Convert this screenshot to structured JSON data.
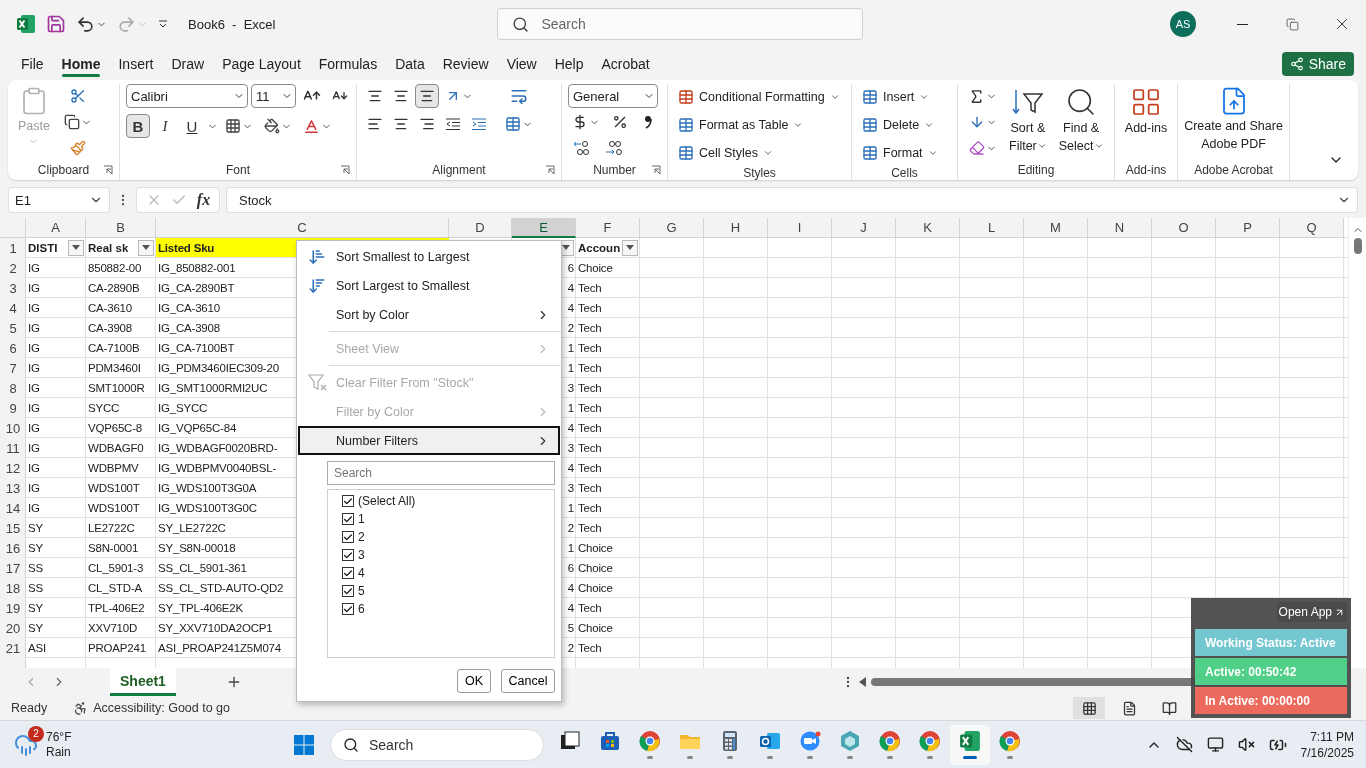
{
  "title_bar": {
    "document_title": "Book6  -  Excel",
    "search_placeholder": "Search",
    "user_initials": "AS"
  },
  "menu_tabs": [
    {
      "label": "File",
      "selected": false
    },
    {
      "label": "Home",
      "selected": true
    },
    {
      "label": "Insert",
      "selected": false
    },
    {
      "label": "Draw",
      "selected": false
    },
    {
      "label": "Page Layout",
      "selected": false
    },
    {
      "label": "Formulas",
      "selected": false
    },
    {
      "label": "Data",
      "selected": false
    },
    {
      "label": "Review",
      "selected": false
    },
    {
      "label": "View",
      "selected": false
    },
    {
      "label": "Help",
      "selected": false
    },
    {
      "label": "Acrobat",
      "selected": false
    }
  ],
  "share_button": "Share",
  "ribbon": {
    "clipboard": {
      "paste": {
        "label": "Paste",
        "disabled": true
      },
      "group_label": "Clipboard"
    },
    "font": {
      "font_name": "Calibri",
      "font_size": "11",
      "bold": {
        "label": "B",
        "on": true
      },
      "italic": {
        "label": "I",
        "on": false
      },
      "underline": {
        "label": "U",
        "on": false
      },
      "group_label": "Font"
    },
    "alignment": {
      "bottom_align_on": true,
      "group_label": "Alignment"
    },
    "number": {
      "format": "General",
      "group_label": "Number"
    },
    "styles": {
      "items": [
        "Conditional Formatting",
        "Format as Table",
        "Cell Styles"
      ],
      "group_label": "Styles"
    },
    "cells": {
      "items": [
        "Insert",
        "Delete",
        "Format"
      ],
      "group_label": "Cells"
    },
    "editing": {
      "sort_filter": [
        "Sort &",
        "Filter"
      ],
      "find_select": [
        "Find &",
        "Select"
      ],
      "group_label": "Editing"
    },
    "addins": {
      "label": "Add-ins",
      "group_label": "Add-ins"
    },
    "acrobat": {
      "lines": [
        "Create and Share",
        "Adobe PDF"
      ],
      "group_label": "Adobe Acrobat"
    }
  },
  "formula_bar": {
    "name_box": "E1",
    "function_symbol": "fx",
    "formula": "Stock"
  },
  "sheet": {
    "columns": [
      {
        "label": "A",
        "selected": false
      },
      {
        "label": "B",
        "selected": false
      },
      {
        "label": "C",
        "selected": false
      },
      {
        "label": "D",
        "selected": false
      },
      {
        "label": "E",
        "selected": true
      },
      {
        "label": "F",
        "selected": false
      },
      {
        "label": "G",
        "selected": false
      },
      {
        "label": "H",
        "selected": false
      },
      {
        "label": "I",
        "selected": false
      },
      {
        "label": "J",
        "selected": false
      },
      {
        "label": "K",
        "selected": false
      },
      {
        "label": "L",
        "selected": false
      },
      {
        "label": "M",
        "selected": false
      },
      {
        "label": "N",
        "selected": false
      },
      {
        "label": "O",
        "selected": false
      },
      {
        "label": "P",
        "selected": false
      },
      {
        "label": "Q",
        "selected": false
      }
    ],
    "header_row": {
      "number": "1",
      "a": {
        "text": "DISTI",
        "filter": true
      },
      "b": {
        "text": "Real sk",
        "filter": true
      },
      "c": {
        "text": "Listed Sku",
        "highlighted": true
      },
      "e": {
        "filter": true
      },
      "f": {
        "text": "Accoun",
        "filter": true
      }
    },
    "rows": [
      {
        "number": "2",
        "a": "IG",
        "b": "850882-00",
        "c": "IG_850882-001",
        "e": "6",
        "f": "Choice"
      },
      {
        "number": "3",
        "a": "IG",
        "b": "CA-2890B",
        "c": "IG_CA-2890BT",
        "e": "4",
        "f": "Tech"
      },
      {
        "number": "4",
        "a": "IG",
        "b": "CA-3610",
        "c": "IG_CA-3610",
        "e": "4",
        "f": "Tech"
      },
      {
        "number": "5",
        "a": "IG",
        "b": "CA-3908",
        "c": "IG_CA-3908",
        "e": "2",
        "f": "Tech"
      },
      {
        "number": "6",
        "a": "IG",
        "b": "CA-7100B",
        "c": "IG_CA-7100BT",
        "e": "1",
        "f": "Tech"
      },
      {
        "number": "7",
        "a": "IG",
        "b": "PDM3460I",
        "c": "IG_PDM3460IEC309-20",
        "e": "1",
        "f": "Tech"
      },
      {
        "number": "8",
        "a": "IG",
        "b": "SMT1000R",
        "c": "IG_SMT1000RMI2UC",
        "e": "3",
        "f": "Tech"
      },
      {
        "number": "9",
        "a": "IG",
        "b": "SYCC",
        "c": "IG_SYCC",
        "e": "1",
        "f": "Tech"
      },
      {
        "number": "10",
        "a": "IG",
        "b": "VQP65C-8",
        "c": "IG_VQP65C-84",
        "e": "4",
        "f": "Tech"
      },
      {
        "number": "11",
        "a": "IG",
        "b": "WDBAGF0",
        "c": "IG_WDBAGF0020BRD-",
        "e": "3",
        "f": "Tech"
      },
      {
        "number": "12",
        "a": "IG",
        "b": "WDBPMV",
        "c": "IG_WDBPMV0040BSL-",
        "e": "4",
        "f": "Tech"
      },
      {
        "number": "13",
        "a": "IG",
        "b": "WDS100T",
        "c": "IG_WDS100T3G0A",
        "e": "3",
        "f": "Tech"
      },
      {
        "number": "14",
        "a": "IG",
        "b": "WDS100T",
        "c": "IG_WDS100T3G0C",
        "e": "1",
        "f": "Tech"
      },
      {
        "number": "15",
        "a": "SY",
        "b": "LE2722C",
        "c": "SY_LE2722C",
        "e": "2",
        "f": "Tech"
      },
      {
        "number": "16",
        "a": "SY",
        "b": "S8N-0001",
        "c": "SY_S8N-00018",
        "e": "1",
        "f": "Choice"
      },
      {
        "number": "17",
        "a": "SS",
        "b": "CL_5901-3",
        "c": "SS_CL_5901-361",
        "e": "6",
        "f": "Choice"
      },
      {
        "number": "18",
        "a": "SS",
        "b": "CL_STD-A",
        "c": "SS_CL_STD-AUTO-QD2",
        "e": "4",
        "f": "Choice"
      },
      {
        "number": "19",
        "a": "SY",
        "b": "TPL-406E2",
        "c": "SY_TPL-406E2K",
        "e": "4",
        "f": "Tech"
      },
      {
        "number": "20",
        "a": "SY",
        "b": "XXV710D",
        "c": "SY_XXV710DA2OCP1",
        "e": "5",
        "f": "Choice"
      },
      {
        "number": "21",
        "a": "ASI",
        "b": "PROAP241",
        "c": "ASI_PROAP241Z5M074",
        "e": "2",
        "f": "Tech"
      }
    ]
  },
  "filter_menu": {
    "sections": [
      {
        "items": [
          {
            "label": "Sort Smallest to Largest",
            "kind": "sort-ascending",
            "disabled": false,
            "submenu": false,
            "selected": false
          },
          {
            "label": "Sort Largest to Smallest",
            "kind": "sort-descending",
            "disabled": false,
            "submenu": false,
            "selected": false
          },
          {
            "label": "Sort by Color",
            "kind": "plain",
            "disabled": false,
            "submenu": true,
            "selected": false
          }
        ]
      },
      {
        "items": [
          {
            "label": "Sheet View",
            "kind": "plain",
            "disabled": true,
            "submenu": true,
            "selected": false
          }
        ]
      },
      {
        "items": [
          {
            "label": "Clear Filter From \"Stock\"",
            "kind": "clear-filter",
            "disabled": true,
            "submenu": false,
            "selected": false
          },
          {
            "label": "Filter by Color",
            "kind": "plain",
            "disabled": true,
            "submenu": true,
            "selected": false
          },
          {
            "label": "Number Filters",
            "kind": "plain",
            "disabled": false,
            "submenu": true,
            "selected": true
          }
        ]
      }
    ],
    "search_placeholder": "Search",
    "values": [
      {
        "label": "(Select All)",
        "checked": true
      },
      {
        "label": "1",
        "checked": true
      },
      {
        "label": "2",
        "checked": true
      },
      {
        "label": "3",
        "checked": true
      },
      {
        "label": "4",
        "checked": true
      },
      {
        "label": "5",
        "checked": true
      },
      {
        "label": "6",
        "checked": true
      }
    ],
    "ok": "OK",
    "cancel": "Cancel"
  },
  "sheet_tabs": [
    {
      "label": "Sheet1",
      "selected": true
    }
  ],
  "status_bar": {
    "ready": "Ready",
    "accessibility": "Accessibility: Good to go"
  },
  "tracker": {
    "open_app": "Open App",
    "rows": [
      {
        "label": "Working Status: Active",
        "color": "#74c6d0"
      },
      {
        "label": "Active: 00:50:42",
        "color": "#4fcf88"
      },
      {
        "label": "In Active: 00:00:00",
        "color": "#ec6a5d"
      }
    ]
  },
  "taskbar": {
    "weather": {
      "badge": "2",
      "temperature": "76°F",
      "condition": "Rain"
    },
    "search_placeholder": "Search",
    "apps": [
      {
        "kind": "task-view",
        "running": false,
        "selected": false
      },
      {
        "kind": "store",
        "running": false,
        "selected": false
      },
      {
        "kind": "browser",
        "running": true,
        "selected": false
      },
      {
        "kind": "folder",
        "running": true,
        "selected": false
      },
      {
        "kind": "calculator",
        "running": true,
        "selected": false
      },
      {
        "kind": "mail",
        "running": true,
        "selected": false
      },
      {
        "kind": "video",
        "running": true,
        "selected": false
      },
      {
        "kind": "hexagon",
        "running": true,
        "selected": false
      },
      {
        "kind": "browser",
        "running": true,
        "selected": false
      },
      {
        "kind": "browser",
        "running": true,
        "selected": false
      },
      {
        "kind": "spreadsheet",
        "running": true,
        "selected": true
      },
      {
        "kind": "browser",
        "running": true,
        "selected": false
      }
    ],
    "time": "7:11 PM",
    "date": "7/16/2025"
  }
}
